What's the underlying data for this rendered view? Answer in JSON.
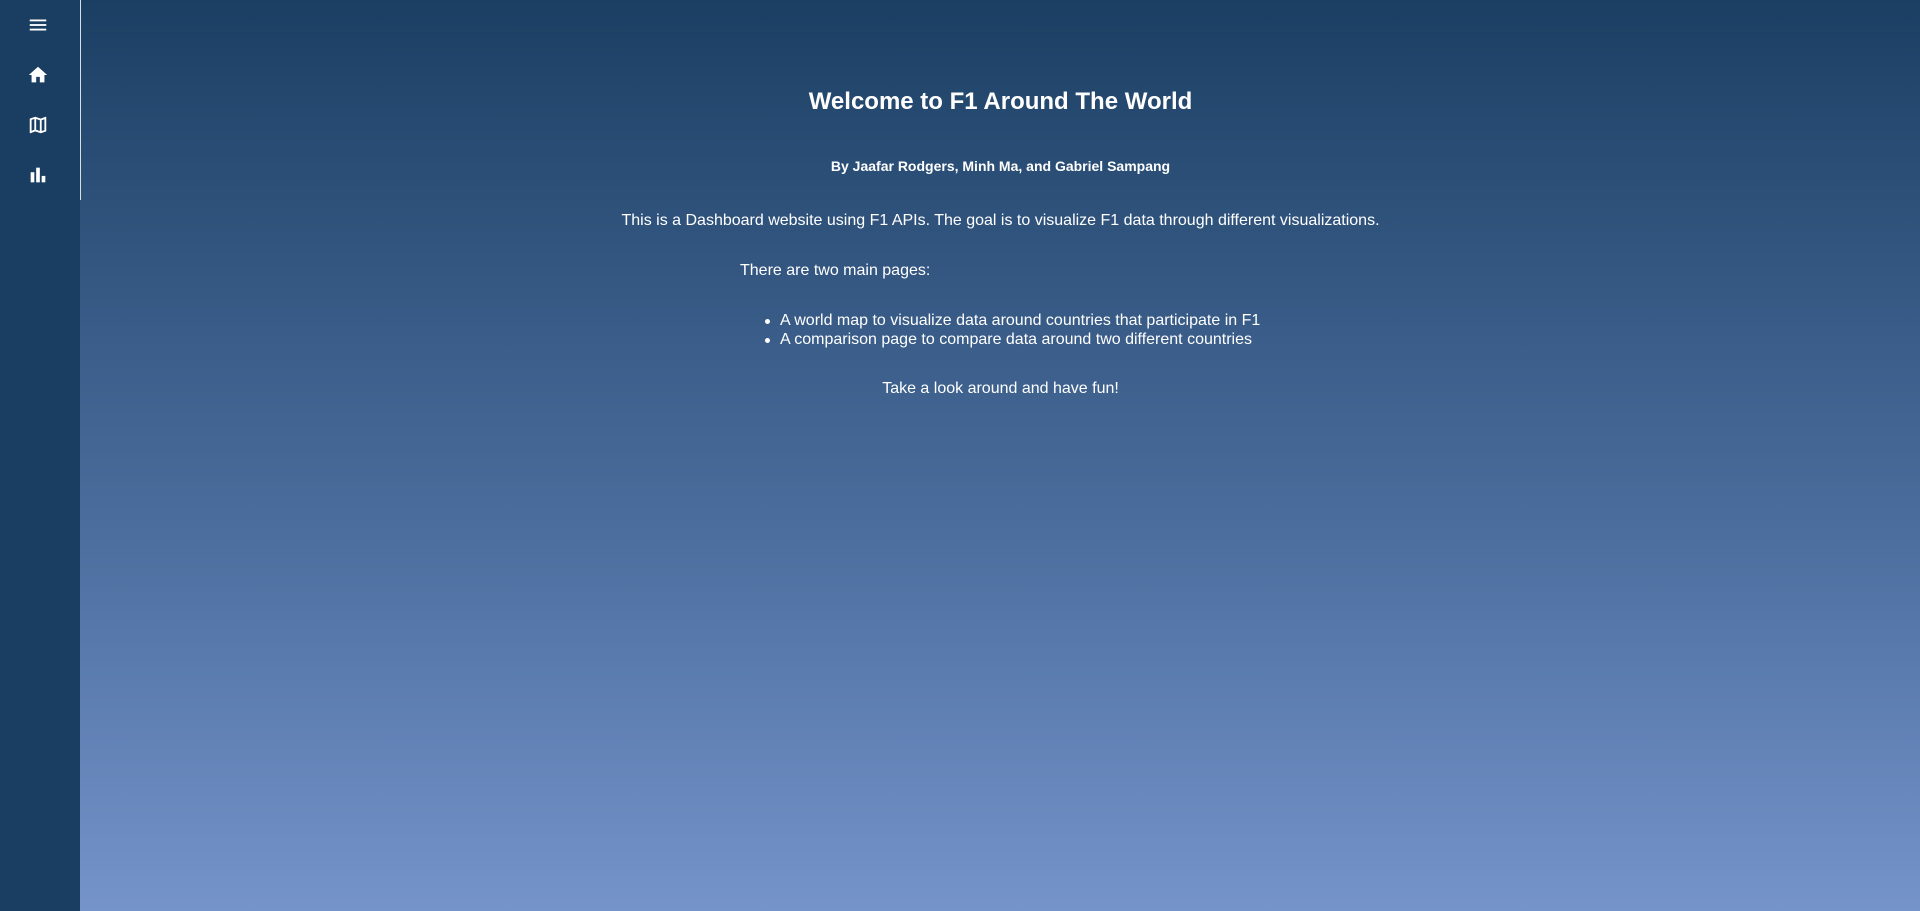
{
  "sidebar": {
    "items": [
      {
        "icon": "menu-icon"
      },
      {
        "icon": "home-icon"
      },
      {
        "icon": "map-icon"
      },
      {
        "icon": "bar-chart-icon"
      }
    ]
  },
  "main": {
    "title": "Welcome to F1 Around The World",
    "byline": "By Jaafar Rodgers, Minh Ma, and Gabriel Sampang",
    "description": "This is a Dashboard website using F1 APIs. The goal is to visualize F1 data through different visualizations.",
    "pages_intro": "There are two main pages:",
    "pages": [
      "A world map to visualize data around countries that participate in F1",
      " A comparison page to compare data around two different countries"
    ],
    "closing": "Take a look around and have fun!"
  },
  "colors": {
    "sidebar": "#1a3e62",
    "gradient_top": "#1b3f63",
    "gradient_bottom": "#7594ca",
    "text": "#ffffff"
  }
}
